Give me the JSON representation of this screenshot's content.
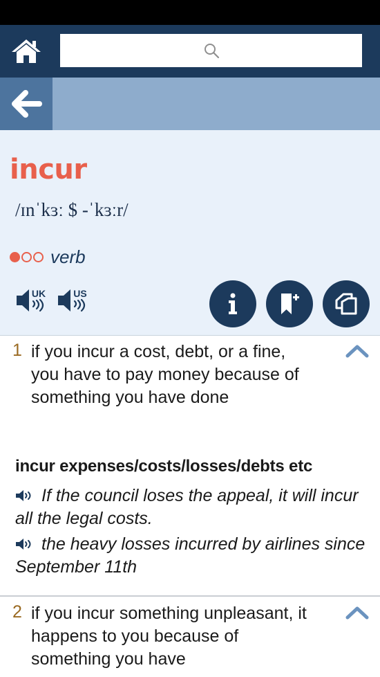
{
  "search": {
    "value": "",
    "placeholder": ""
  },
  "entry": {
    "headword": "incur",
    "pronunciation": "/ɪnˈkɜː $ -ˈkɜːr/",
    "frequency": {
      "filled": 1,
      "total": 3
    },
    "part_of_speech": "verb",
    "audio": [
      {
        "label": "UK",
        "icon": "speaker-uk-icon"
      },
      {
        "label": "US",
        "icon": "speaker-us-icon"
      }
    ],
    "actions": [
      "info-icon",
      "add-bookmark-icon",
      "copy-icon"
    ]
  },
  "senses": [
    {
      "number": "1",
      "definition": "if you incur a cost, debt, or a fine, you have to pay money because of something you have done",
      "collocation": "incur expenses/costs/losses/debts etc",
      "examples": [
        "If the council loses the appeal, it will incur all the legal costs.",
        "the heavy losses incurred by airlines since September 11th"
      ]
    },
    {
      "number": "2",
      "definition": "if you incur something unpleasant, it happens to you because of something you have"
    }
  ],
  "colors": {
    "headword": "#e8604c",
    "navy": "#1c3a5c",
    "back_bar": "#8eaccc",
    "panel_bg": "#e9f1fa",
    "sense_number": "#9a6a22",
    "chevron": "#6b93bf"
  }
}
